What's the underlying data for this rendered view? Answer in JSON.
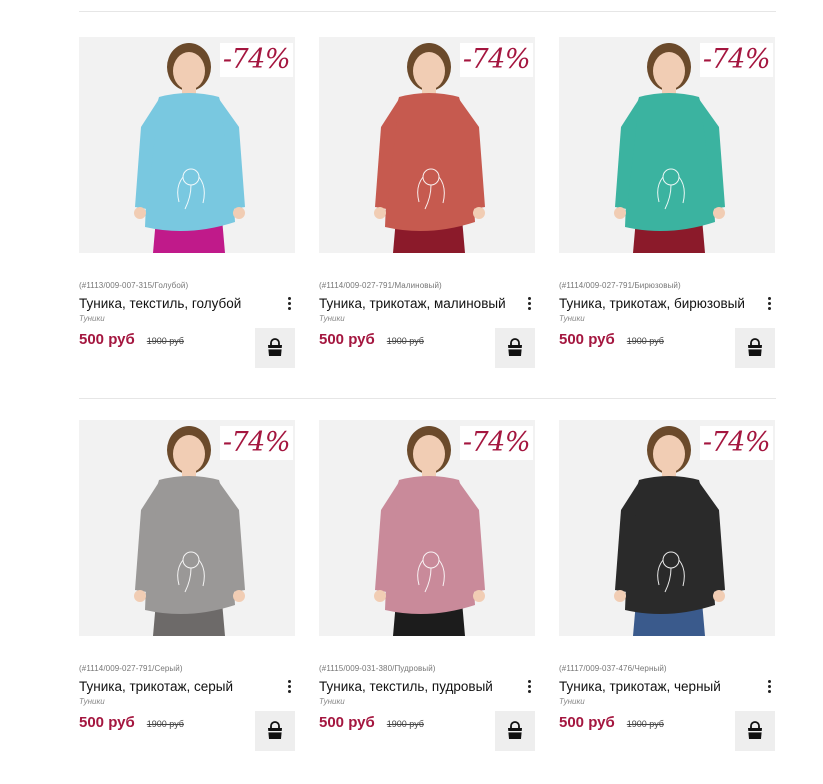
{
  "colors": {
    "accent": "#a4163f",
    "badge_text": "#a4163f",
    "button_bg": "#eeeeee"
  },
  "products": [
    {
      "sku": "(#1113/009-007-315/Голубой)",
      "title": "Туника, текстиль, голубой",
      "category": "Туники",
      "price": "500 руб",
      "old_price": "1900 руб",
      "discount": "-74%",
      "image_icon": "product-photo-blue-floral-tunic",
      "garment_color": "#79c8e0",
      "pants_color": "#c01a8a"
    },
    {
      "sku": "(#1114/009-027-791/Малиновый)",
      "title": "Туника, трикотаж, малиновый",
      "category": "Туники",
      "price": "500 руб",
      "old_price": "1900 руб",
      "discount": "-74%",
      "image_icon": "product-photo-raspberry-tunic",
      "garment_color": "#c65a4f",
      "pants_color": "#8b1a2a"
    },
    {
      "sku": "(#1114/009-027-791/Бирюзовый)",
      "title": "Туника, трикотаж, бирюзовый",
      "category": "Туники",
      "price": "500 руб",
      "old_price": "1900 руб",
      "discount": "-74%",
      "image_icon": "product-photo-turquoise-tunic",
      "garment_color": "#3bb3a0",
      "pants_color": "#8b1a2a"
    },
    {
      "sku": "(#1114/009-027-791/Серый)",
      "title": "Туника, трикотаж, серый",
      "category": "Туники",
      "price": "500 руб",
      "old_price": "1900 руб",
      "discount": "-74%",
      "image_icon": "product-photo-grey-tunic",
      "garment_color": "#9a9897",
      "pants_color": "#6d6a69"
    },
    {
      "sku": "(#1115/009-031-380/Пудровый)",
      "title": "Туника, текстиль, пудровый",
      "category": "Туники",
      "price": "500 руб",
      "old_price": "1900 руб",
      "discount": "-74%",
      "image_icon": "product-photo-powder-tunic",
      "garment_color": "#c98a9a",
      "pants_color": "#1c1c1c"
    },
    {
      "sku": "(#1117/009-037-476/Черный)",
      "title": "Туника, трикотаж, черный",
      "category": "Туники",
      "price": "500 руб",
      "old_price": "1900 руб",
      "discount": "-74%",
      "image_icon": "product-photo-black-print-tunic",
      "garment_color": "#2a2a2a",
      "pants_color": "#3a5a8c"
    }
  ],
  "icons": {
    "menu": "more-vertical-icon",
    "cart": "shopping-bag-icon"
  }
}
